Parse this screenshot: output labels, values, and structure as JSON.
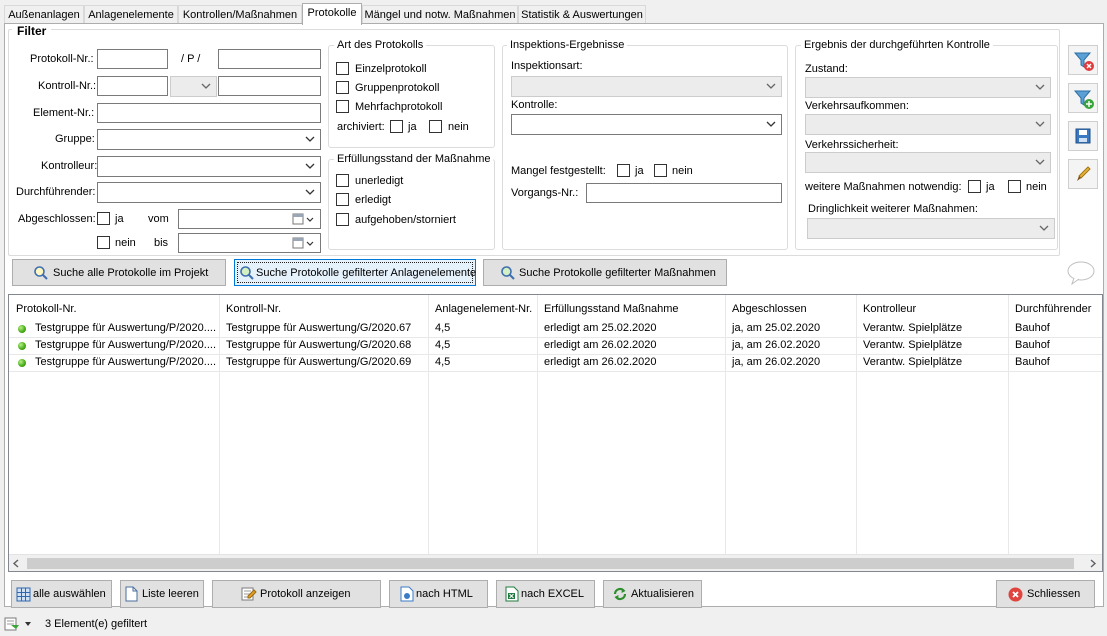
{
  "tabs": [
    "Außenanlagen",
    "Anlagenelemente",
    "Kontrollen/Maßnahmen",
    "Protokolle",
    "Mängel und notw. Maßnahmen",
    "Statistik & Auswertungen"
  ],
  "filter": {
    "title": "Filter",
    "protokoll_nr_label": "Protokoll-Nr.:",
    "p_separator": "/ P /",
    "kontroll_nr_label": "Kontroll-Nr.:",
    "element_nr_label": "Element-Nr.:",
    "gruppe_label": "Gruppe:",
    "kontrolleur_label": "Kontrolleur:",
    "durchfuehrender_label": "Durchführender:",
    "abgeschlossen_label": "Abgeschlossen:",
    "ja": "ja",
    "nein": "nein",
    "vom": "vom",
    "bis": "bis"
  },
  "art": {
    "title": "Art des Protokolls",
    "einzel": "Einzelprotokoll",
    "gruppen": "Gruppenprotokoll",
    "mehrfach": "Mehrfachprotokoll",
    "archiviert": "archiviert:",
    "ja": "ja",
    "nein": "nein"
  },
  "erfuellung": {
    "title": "Erfüllungsstand der Maßnahme",
    "unerledigt": "unerledigt",
    "erledigt": "erledigt",
    "aufgehoben": "aufgehoben/storniert"
  },
  "inspektion": {
    "title": "Inspektions-Ergebnisse",
    "inspektionsart": "Inspektionsart:",
    "kontrolle": "Kontrolle:",
    "mangel": "Mangel festgestellt:",
    "ja": "ja",
    "nein": "nein",
    "vorgangs_nr": "Vorgangs-Nr.:"
  },
  "ergebnis": {
    "title": "Ergebnis der durchgeführten Kontrolle",
    "zustand": "Zustand:",
    "verkehrsaufkommen": "Verkehrsaufkommen:",
    "verkehrssicherheit": "Verkehrssicherheit:",
    "weitere": "weitere Maßnahmen notwendig:",
    "ja": "ja",
    "nein": "nein",
    "dringlichkeit": "Dringlichkeit weiterer Maßnahmen:"
  },
  "search_buttons": {
    "alle": "Suche alle Protokolle im Projekt",
    "anlagen": "Suche Protokolle gefilterter Anlagenelemente",
    "massnahmen": "Suche Protokolle gefilterter Maßnahmen"
  },
  "table": {
    "columns": [
      "Protokoll-Nr.",
      "Kontroll-Nr.",
      "Anlagenelement-Nr.",
      "Erfüllungsstand Maßnahme",
      "Abgeschlossen",
      "Kontrolleur",
      "Durchführender"
    ],
    "rows": [
      [
        "Testgruppe für Auswertung/P/2020....",
        "Testgruppe für Auswertung/G/2020.67",
        "4,5",
        "erledigt am 25.02.2020",
        "ja, am 25.02.2020",
        "Verantw. Spielplätze",
        "Bauhof"
      ],
      [
        "Testgruppe für Auswertung/P/2020....",
        "Testgruppe für Auswertung/G/2020.68",
        "4,5",
        "erledigt am 26.02.2020",
        "ja, am 26.02.2020",
        "Verantw. Spielplätze",
        "Bauhof"
      ],
      [
        "Testgruppe für Auswertung/P/2020....",
        "Testgruppe für Auswertung/G/2020.69",
        "4,5",
        "erledigt am 26.02.2020",
        "ja, am 26.02.2020",
        "Verantw. Spielplätze",
        "Bauhof"
      ]
    ]
  },
  "bottom_buttons": {
    "alle_auswaehlen": "alle auswählen",
    "liste_leeren": "Liste leeren",
    "protokoll_anzeigen": "Protokoll anzeigen",
    "nach_html": "nach HTML",
    "nach_excel": "nach EXCEL",
    "aktualisieren": "Aktualisieren",
    "schliessen": "Schliessen"
  },
  "status": {
    "text": "3 Element(e) gefiltert"
  }
}
